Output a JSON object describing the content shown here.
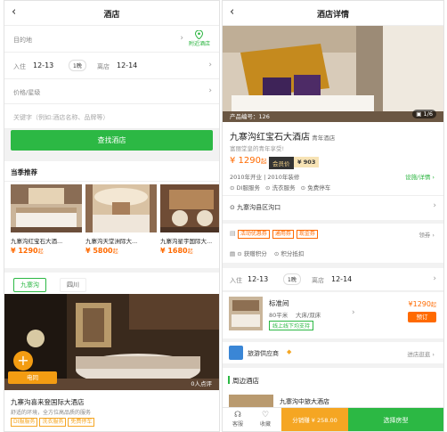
{
  "left": {
    "title": "酒店",
    "destination_label": "目的地",
    "nearby_label": "附近酒店",
    "checkin_label": "入住",
    "checkin_date": "12-13",
    "nights": "1晚",
    "checkout_label": "离店",
    "checkout_date": "12-14",
    "price_placeholder": "价格/星级",
    "keyword_placeholder": "关键字（例如:酒店名称、品牌等）",
    "search_button": "查找酒店",
    "recommend_title": "当季推荐",
    "recommend": [
      {
        "name": "九寨沟红宝石大酒...",
        "price": "¥ 1290",
        "unit": "起"
      },
      {
        "name": "九寨沟天堂洲际大...",
        "price": "¥ 5800",
        "unit": "起"
      },
      {
        "name": "九寨沟星宇国际大...",
        "price": "¥ 1680",
        "unit": "起"
      }
    ],
    "tabs": [
      "九寨沟",
      "四川"
    ],
    "feature_badge": "电同",
    "feature_viewers": "0人点评",
    "feature_name": "九寨沟喜来登国际大酒店",
    "feature_desc": "舒适的环境，全方位高品质的服务",
    "feature_tags": [
      "DI服服务",
      "洗衣服务",
      "免费停车"
    ]
  },
  "right": {
    "title": "酒店详情",
    "photo_label": "产品编号：126",
    "photo_count": "1/6",
    "hotel_name": "九寨沟红宝石大酒店",
    "hotel_type": "青年酒店",
    "tagline": "富丽堂皇的青年享受!",
    "price": "¥ 1290",
    "price_unit": "起",
    "member_label": "会员价",
    "member_price": "¥ 903",
    "open_info": "2010年开业 | 2010年装修",
    "facility_link": "设施/详情",
    "services": [
      "DI服服务",
      "洗衣服务",
      "免费停车"
    ],
    "address": "九寨沟县区沟口",
    "promos": [
      "活动优惠券",
      "通用券",
      "现金券"
    ],
    "collect_label": "领券",
    "points": [
      "获赠积分",
      "积分抵扣"
    ],
    "checkin_label": "入住",
    "checkin_date": "12-13",
    "nights": "1晚",
    "checkout_label": "离店",
    "checkout_date": "12-14",
    "room_name": "标准间",
    "room_size": "80平米",
    "room_bed": "大床/双床",
    "room_tag": "线上线下均支持",
    "room_price": "¥1290",
    "room_price_unit": "起",
    "book_button": "预订",
    "supplier": "旅游供应商",
    "supplier_link": "进店逛逛",
    "nearby_title": "周边酒店",
    "nearby_name": "九寨沟中旅大酒店",
    "bottom_service": "客服",
    "bottom_collect": "收藏",
    "share_button": "分销赚 ¥ 258.00",
    "select_button": "选择房型"
  },
  "colors": {
    "green": "#2cb844",
    "orange": "#ff6a00",
    "gold": "#f5a623"
  }
}
